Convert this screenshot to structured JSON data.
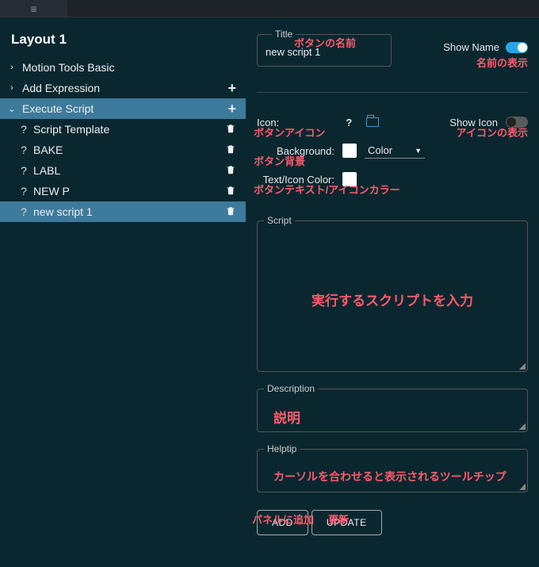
{
  "layout_title": "Layout 1",
  "tree": {
    "items": [
      {
        "label": "Motion Tools Basic",
        "expanded": false
      },
      {
        "label": "Add Expression",
        "expanded": false,
        "addable": true
      },
      {
        "label": "Execute Script",
        "expanded": true,
        "addable": true,
        "selected": true
      }
    ],
    "children": [
      {
        "label": "Script Template"
      },
      {
        "label": "BAKE"
      },
      {
        "label": "LABL"
      },
      {
        "label": "NEW P"
      },
      {
        "label": "new script 1",
        "selected": true
      }
    ]
  },
  "props": {
    "title_legend": "Title",
    "title_value": "new script 1",
    "show_name_label": "Show Name",
    "show_name_on": true,
    "icon_label": "Icon:",
    "show_icon_label": "Show Icon",
    "show_icon_on": false,
    "background_label": "Background:",
    "color_label": "Color",
    "text_icon_color_label": "Text/Icon Color:",
    "script_legend": "Script",
    "description_legend": "Description",
    "helptip_legend": "Helptip",
    "add_button": "ADD",
    "update_button": "UPDATE"
  },
  "anno": {
    "title": "ボタンの名前",
    "show_name": "名前の表示",
    "icon": "ボタンアイコン",
    "show_icon": "アイコンの表示",
    "background": "ボタン背景",
    "text_color": "ボタンテキスト/アイコンカラー",
    "script": "実行するスクリプトを入力",
    "description": "説明",
    "helptip": "カーソルを合わせると表示されるツールチップ",
    "add": "パネルに追加",
    "update": "更新"
  }
}
